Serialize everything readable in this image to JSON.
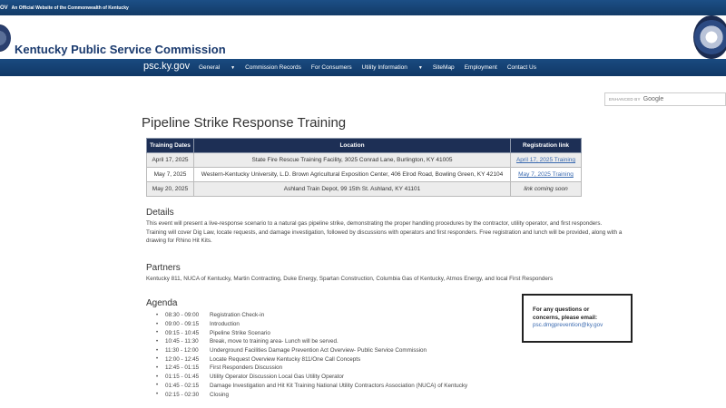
{
  "topbar": {
    "gov_text": "OV",
    "official_text": "An Official Website of the Commonwealth of Kentucky"
  },
  "header": {
    "title": "Kentucky Public Service Commission"
  },
  "nav": {
    "brand": "psc.ky.gov",
    "items": [
      "General",
      "Commission Records",
      "For Consumers",
      "Utility Information",
      "SiteMap",
      "Employment",
      "Contact Us"
    ]
  },
  "search": {
    "enhanced": "ENHANCED BY",
    "google": "Google"
  },
  "page": {
    "title": "Pipeline Strike Response Training"
  },
  "table": {
    "headers": [
      "Training Dates",
      "Location",
      "Registration link"
    ],
    "rows": [
      {
        "date": "April 17, 2025",
        "location": "State Fire Rescue Training Facility, 3025 Conrad Lane, Burlington, KY 41005",
        "reg": "April 17, 2025 Training"
      },
      {
        "date": "May 7, 2025",
        "location": "Western-Kentucky University, L.D. Brown Agricultural Exposition Center, 406 Elrod Road, Bowling Green, KY 42104",
        "reg": "May 7, 2025 Training"
      },
      {
        "date": "May 20, 2025",
        "location": "Ashland Train Depot, 99 15th St. Ashland, KY 41101",
        "reg": "link coming soon"
      }
    ]
  },
  "details": {
    "heading": "Details",
    "text": "This event will present a live-response scenario to a natural gas pipeline strike, demonstrating the proper handling procedures by the contractor, utility operator, and first responders. Training will cover Dig Law, locate requests, and damage investigation, followed by discussions with operators and first responders. Free registration and lunch will be provided, along with a drawing for Rhino Hit Kits."
  },
  "partners": {
    "heading": "Partners",
    "text": "Kentucky 811, NUCA of Kentucky, Martin Contracting, Duke Energy, Spartan Construction, Columbia Gas of Kentucky, Atmos Energy, and local First Responders"
  },
  "agenda": {
    "heading": "Agenda",
    "items": [
      {
        "time": "08:30 - 09:00",
        "text": "Registration Check-in"
      },
      {
        "time": "09:00 - 09:15",
        "text": "Introduction"
      },
      {
        "time": "09:15 - 10:45",
        "text": "Pipeline Strike Scenario"
      },
      {
        "time": "10:45 - 11:30",
        "text": "Break, move to training area- Lunch will be served."
      },
      {
        "time": "11:30 - 12:00",
        "text": "Underground Facilities Damage Prevention Act Overview- Public Service Commission"
      },
      {
        "time": "12:00 - 12:45",
        "text": "Locate Request Overview Kentucky 811/One Call Concepts"
      },
      {
        "time": "12:45 - 01:15",
        "text": "First Responders Discussion"
      },
      {
        "time": "01:15 - 01:45",
        "text": "Utility Operator Discussion Local Gas Utility Operator"
      },
      {
        "time": "01:45 - 02:15",
        "text": "Damage Investigation and Hit Kit Training National Utility Contractors Association (NUCA) of Kentucky"
      },
      {
        "time": "02:15 - 02:30",
        "text": "Closing"
      }
    ]
  },
  "contact": {
    "line1": "For any questions or",
    "line2": "concerns, please email:",
    "email": "psc.dmgprevention@ky.gov"
  }
}
